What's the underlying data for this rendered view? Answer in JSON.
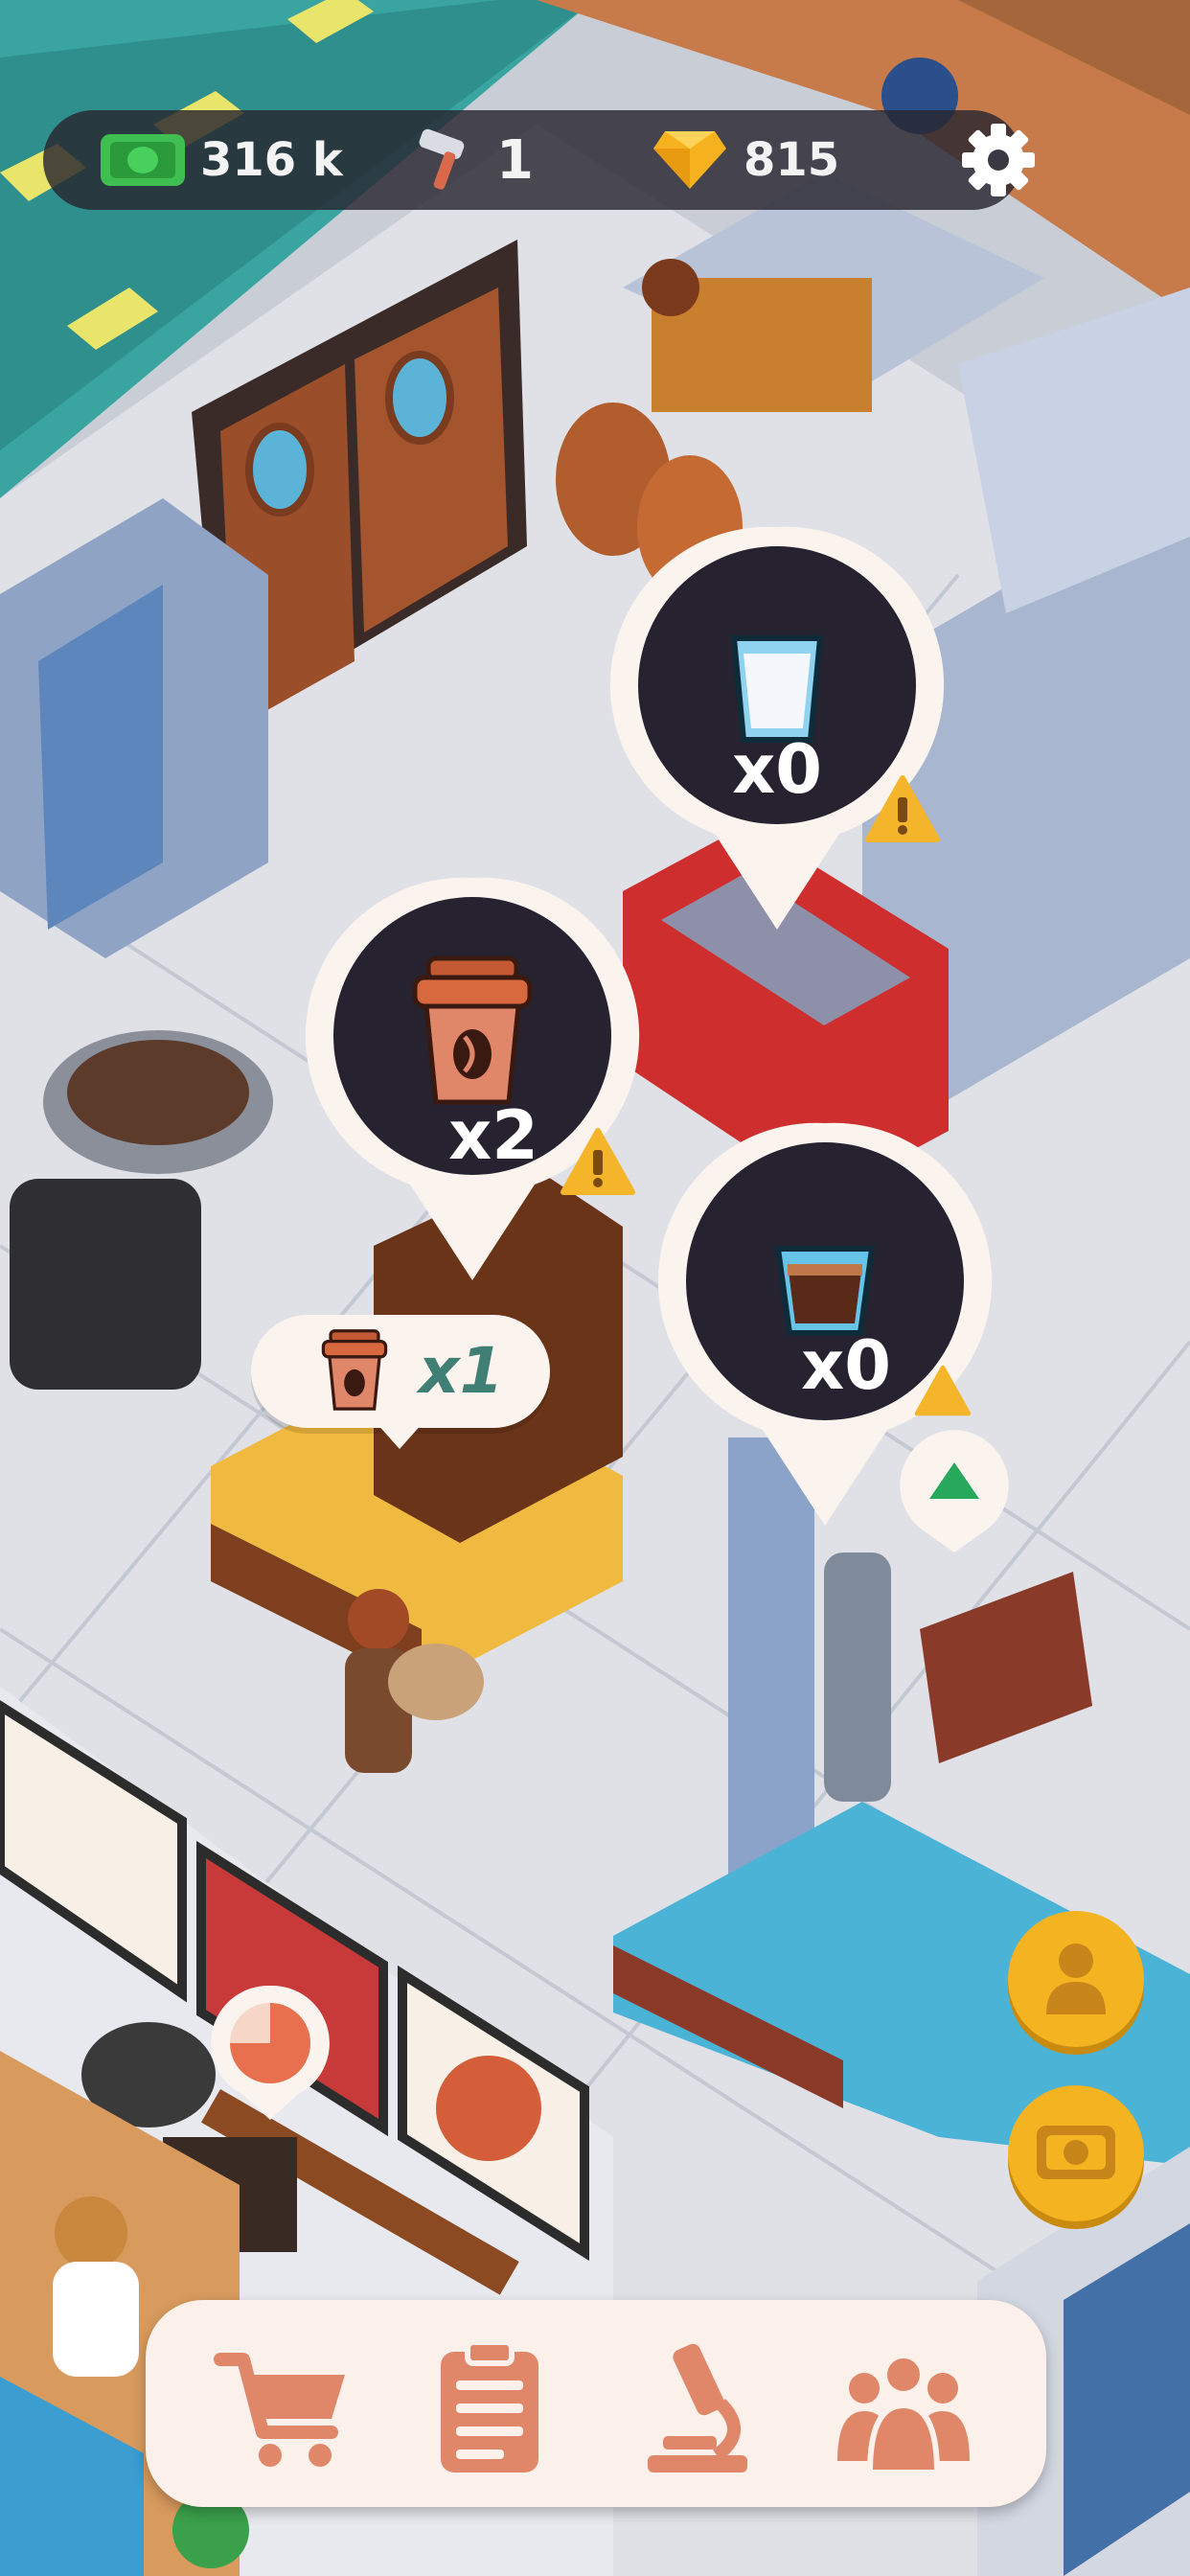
{
  "hud": {
    "cash": "316 k",
    "cash_icon": "cash-icon",
    "hammers": "1",
    "hammer_icon": "hammer-icon",
    "gems": "815",
    "gem_icon": "gem-icon",
    "settings_icon": "gear-icon"
  },
  "bubbles": [
    {
      "item": "milk-glass",
      "count": "x0",
      "warning": true
    },
    {
      "item": "coffee-cup",
      "count": "x2",
      "warning": true
    },
    {
      "item": "espresso-glass",
      "count": "x0",
      "warning": true
    }
  ],
  "order": {
    "item": "coffee-cup",
    "count": "x1"
  },
  "side_buttons": [
    {
      "name": "manager-button",
      "icon": "person-icon"
    },
    {
      "name": "cash-boost-button",
      "icon": "cash-icon"
    }
  ],
  "nav": [
    {
      "name": "shop",
      "icon": "cart-icon"
    },
    {
      "name": "tasks",
      "icon": "clipboard-icon"
    },
    {
      "name": "research",
      "icon": "microscope-icon"
    },
    {
      "name": "staff",
      "icon": "people-icon"
    }
  ],
  "colors": {
    "accent_orange": "#e0876a",
    "gold": "#f4b320",
    "warning": "#f5b52a",
    "hud_bg": "#28262f"
  }
}
